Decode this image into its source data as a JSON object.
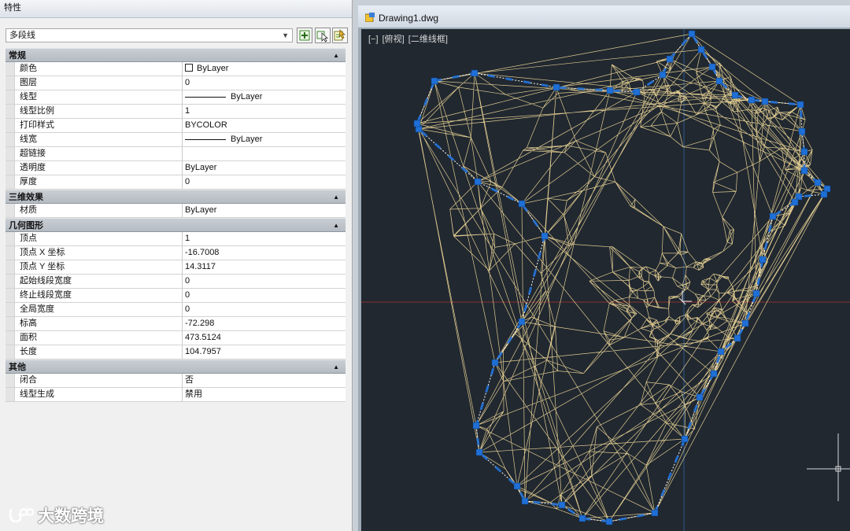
{
  "palette": {
    "title": "特性",
    "object_type": "多段线",
    "buttons": [
      "toggle-pickadd",
      "select-objects",
      "quick-select"
    ],
    "sections": [
      {
        "title": "常规",
        "rows": [
          {
            "name": "颜色",
            "value": "ByLayer",
            "swatch": "#ffffff"
          },
          {
            "name": "图层",
            "value": "0"
          },
          {
            "name": "线型",
            "value": "ByLayer",
            "linetype": true
          },
          {
            "name": "线型比例",
            "value": "1"
          },
          {
            "name": "打印样式",
            "value": "BYCOLOR"
          },
          {
            "name": "线宽",
            "value": "ByLayer",
            "linetype": true
          },
          {
            "name": "超链接",
            "value": ""
          },
          {
            "name": "透明度",
            "value": "ByLayer"
          },
          {
            "name": "厚度",
            "value": "0"
          }
        ]
      },
      {
        "title": "三维效果",
        "rows": [
          {
            "name": "材质",
            "value": "ByLayer"
          }
        ]
      },
      {
        "title": "几何图形",
        "rows": [
          {
            "name": "顶点",
            "value": "1"
          },
          {
            "name": "顶点 X 坐标",
            "value": "-16.7008"
          },
          {
            "name": "顶点 Y 坐标",
            "value": "14.3117"
          },
          {
            "name": "起始线段宽度",
            "value": "0"
          },
          {
            "name": "终止线段宽度",
            "value": "0"
          },
          {
            "name": "全局宽度",
            "value": "0"
          },
          {
            "name": "标高",
            "value": "-72.298"
          },
          {
            "name": "面积",
            "value": "473.5124"
          },
          {
            "name": "长度",
            "value": "104.7957"
          }
        ]
      },
      {
        "title": "其他",
        "rows": [
          {
            "name": "闭合",
            "value": "否"
          },
          {
            "name": "线型生成",
            "value": "禁用"
          }
        ]
      }
    ]
  },
  "drawing": {
    "title": "Drawing1.dwg",
    "view_controls": [
      "[−]",
      "[俯视]",
      "[二维线框]"
    ],
    "colors": {
      "background": "#212830",
      "mesh": "#f3dc9a",
      "grips": "#1f6fd6",
      "axis_x": "#8a3030",
      "axis_y": "#2f5a8a",
      "crosshair": "#d8d8d8"
    }
  },
  "watermark": {
    "text": "大数跨境"
  }
}
